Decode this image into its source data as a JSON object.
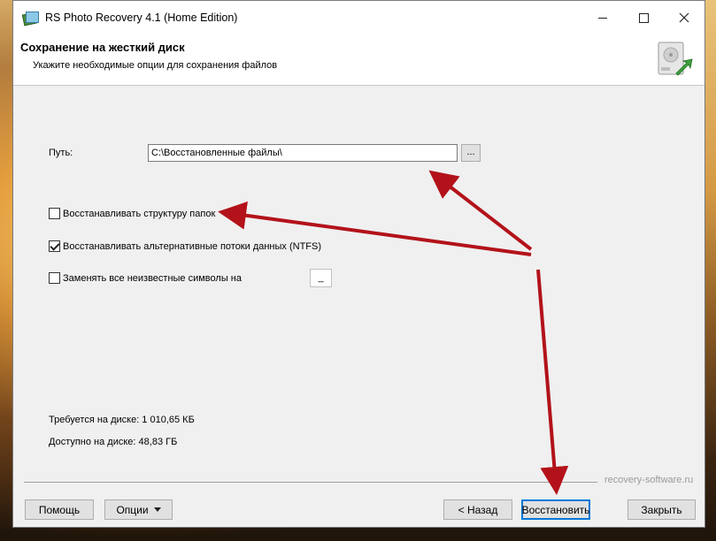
{
  "window": {
    "title": "RS Photo Recovery 4.1 (Home Edition)",
    "controls": {
      "minimize": "minimize",
      "maximize": "maximize",
      "close": "close"
    }
  },
  "header": {
    "title": "Сохранение на жесткий диск",
    "subtitle": "Укажите необходимые опции для сохранения файлов",
    "icon": "hard-disk-export-icon"
  },
  "path": {
    "label": "Путь:",
    "value": "C:\\Восстановленные файлы\\",
    "browse_label": "..."
  },
  "options": [
    {
      "label": "Восстанавливать структуру папок",
      "checked": false
    },
    {
      "label": "Восстанавливать альтернативные потоки данных (NTFS)",
      "checked": true
    },
    {
      "label": "Заменять все неизвестные символы на",
      "checked": false
    }
  ],
  "replace_char": "_",
  "disk": {
    "required": "Требуется на диске: 1 010,65 КБ",
    "available": "Доступно на диске: 48,83 ГБ"
  },
  "watermark": "recovery-software.ru",
  "buttons": {
    "help": "Помощь",
    "options": "Опции",
    "back": "< Назад",
    "restore": "Восстановить",
    "close": "Закрыть"
  },
  "colors": {
    "annotation_arrow": "#b3121a",
    "focus_border": "#0078d7"
  }
}
